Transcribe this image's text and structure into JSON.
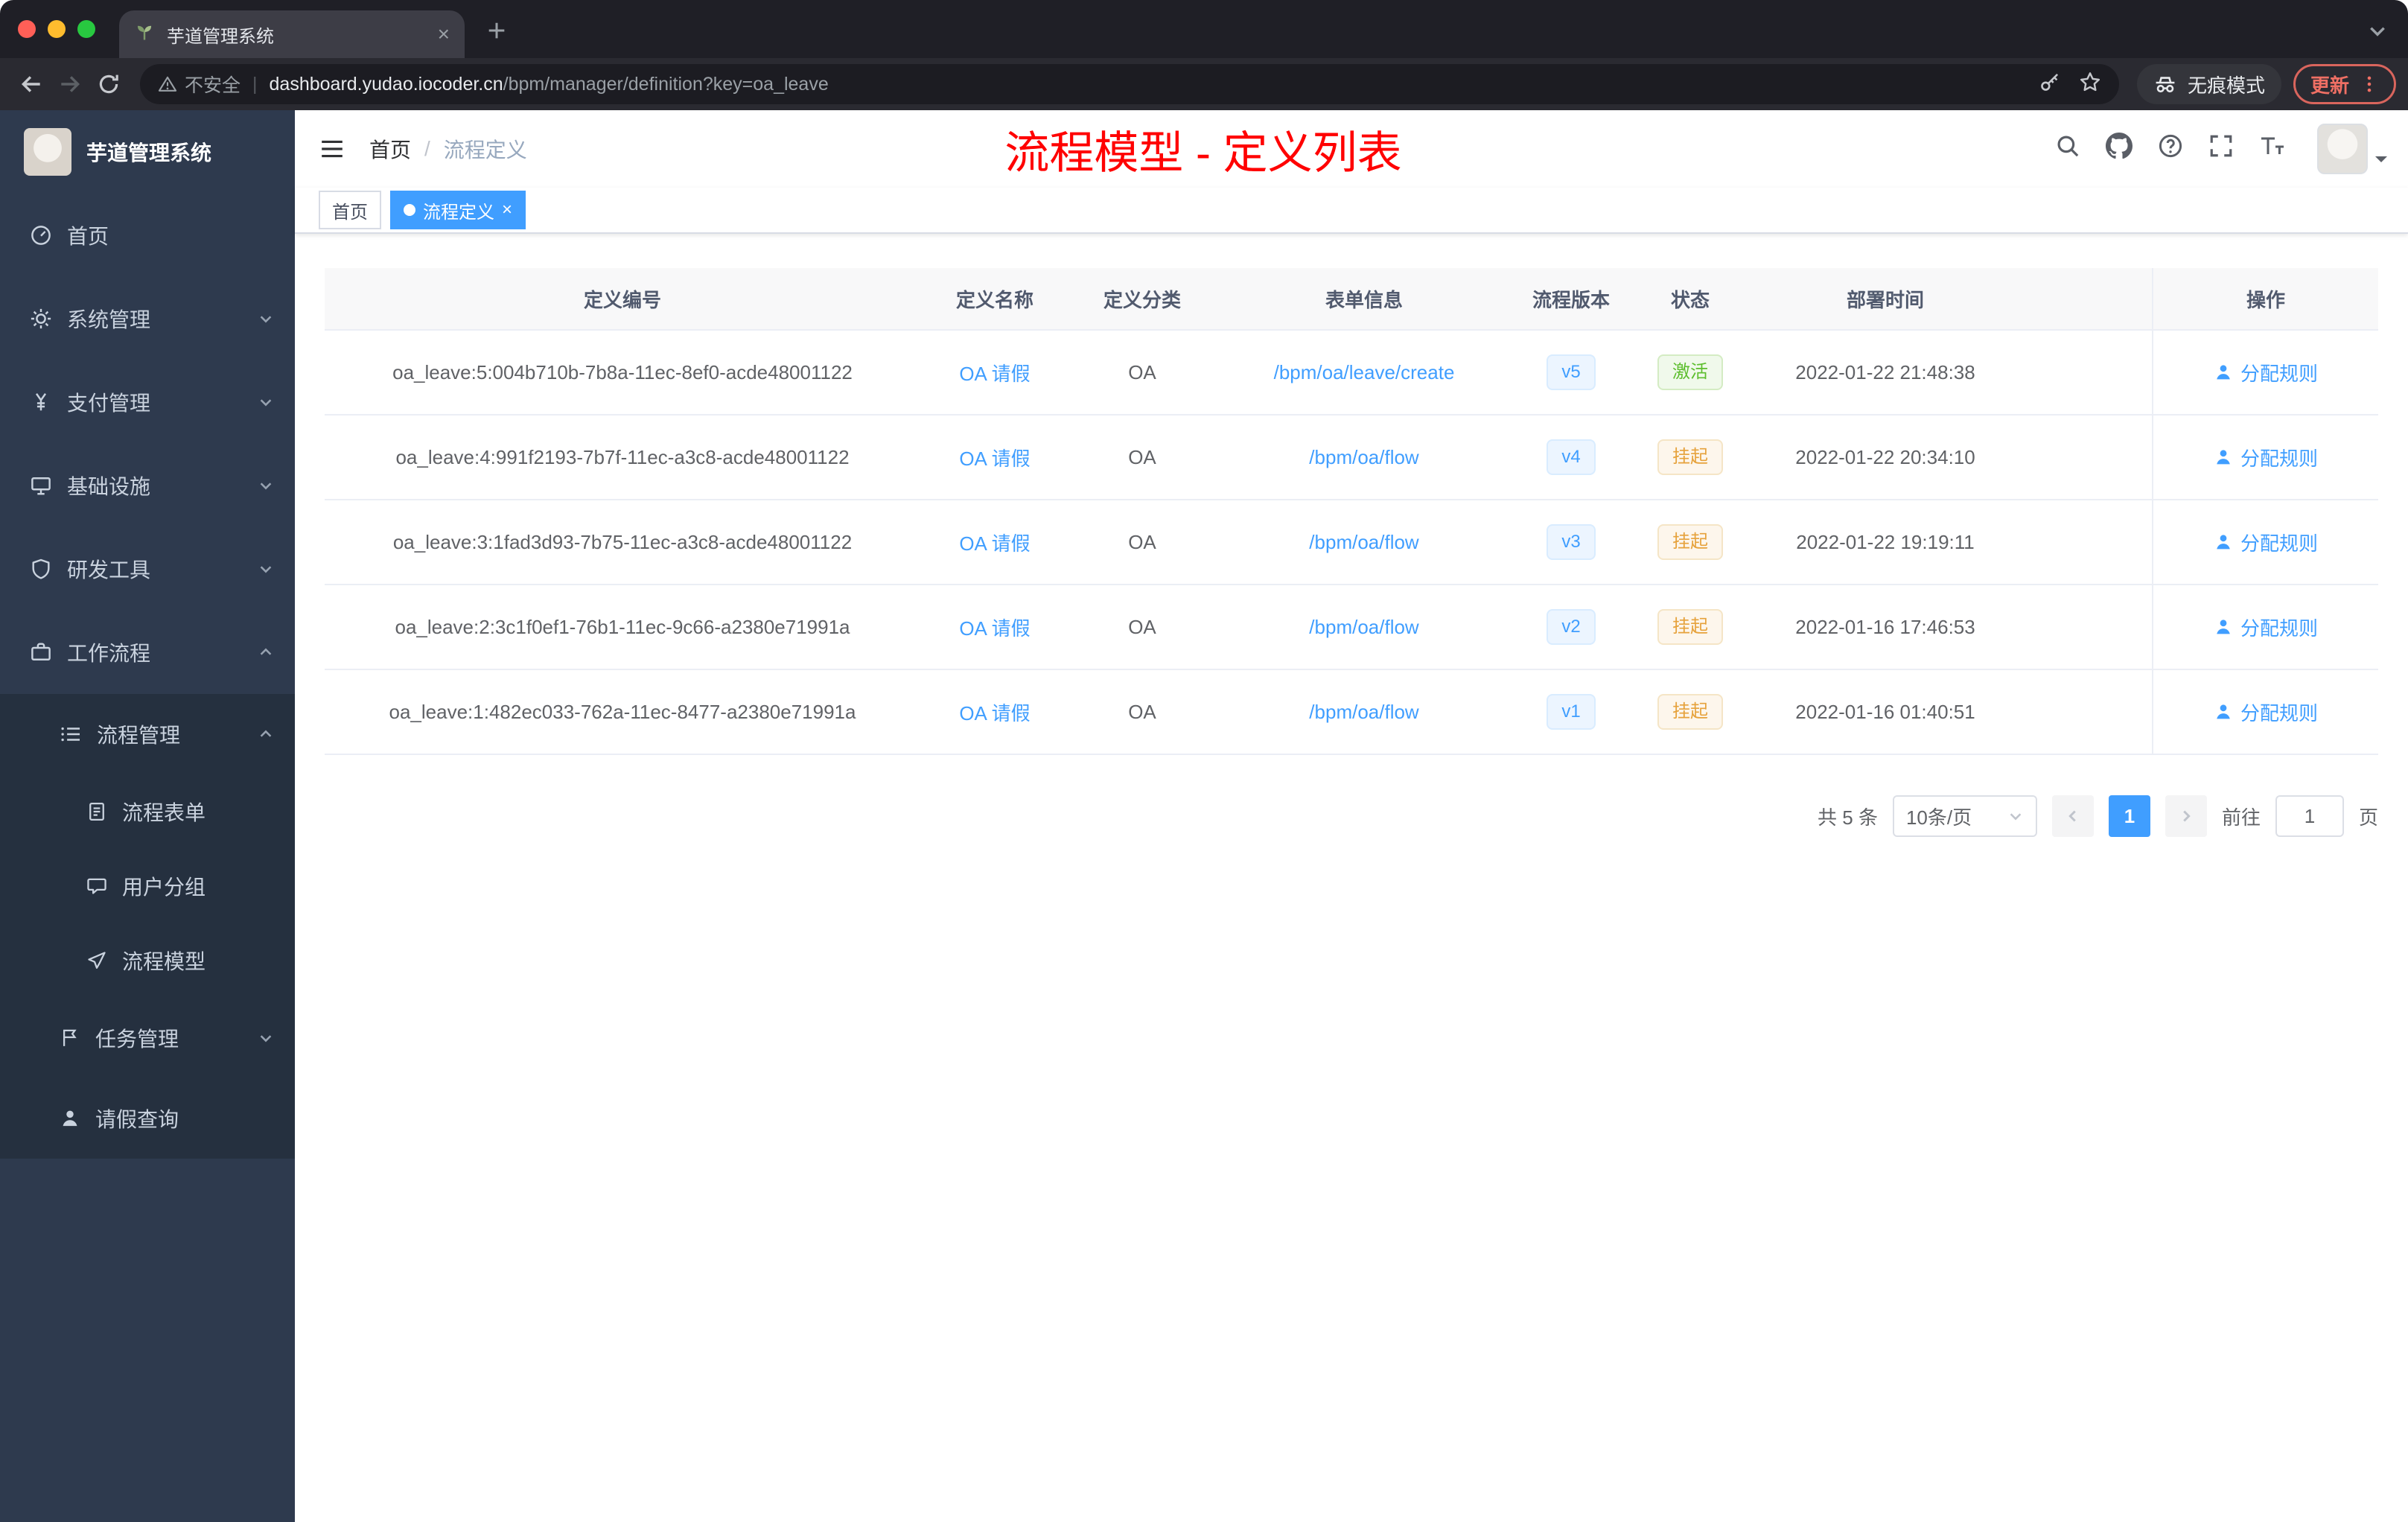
{
  "browser": {
    "tab_title": "芋道管理系统",
    "tab_close": "×",
    "security_label": "不安全",
    "url_domain": "dashboard.yudao.iocoder.cn",
    "url_path": "/bpm/manager/definition?key=oa_leave",
    "incognito_label": "无痕模式",
    "update_label": "更新"
  },
  "sidebar": {
    "logo_title": "芋道管理系统",
    "items": [
      {
        "label": "首页"
      },
      {
        "label": "系统管理"
      },
      {
        "label": "支付管理"
      },
      {
        "label": "基础设施"
      },
      {
        "label": "研发工具"
      },
      {
        "label": "工作流程"
      },
      {
        "label": "流程管理"
      },
      {
        "label": "流程表单"
      },
      {
        "label": "用户分组"
      },
      {
        "label": "流程模型"
      },
      {
        "label": "任务管理"
      },
      {
        "label": "请假查询"
      }
    ]
  },
  "navbar": {
    "breadcrumb_home": "首页",
    "breadcrumb_separator": "/",
    "breadcrumb_current": "流程定义",
    "page_title": "流程模型 - 定义列表"
  },
  "tags_view": {
    "home": "首页",
    "active": "流程定义",
    "close": "×"
  },
  "table": {
    "columns": [
      "定义编号",
      "定义名称",
      "定义分类",
      "表单信息",
      "流程版本",
      "状态",
      "部署时间",
      "操作"
    ],
    "rows": [
      {
        "id": "oa_leave:5:004b710b-7b8a-11ec-8ef0-acde48001122",
        "name": "OA 请假",
        "category": "OA",
        "form": "/bpm/oa/leave/create",
        "version": "v5",
        "status": "激活",
        "time": "2022-01-22 21:48:38",
        "action": "分配规则"
      },
      {
        "id": "oa_leave:4:991f2193-7b7f-11ec-a3c8-acde48001122",
        "name": "OA 请假",
        "category": "OA",
        "form": "/bpm/oa/flow",
        "version": "v4",
        "status": "挂起",
        "time": "2022-01-22 20:34:10",
        "action": "分配规则"
      },
      {
        "id": "oa_leave:3:1fad3d93-7b75-11ec-a3c8-acde48001122",
        "name": "OA 请假",
        "category": "OA",
        "form": "/bpm/oa/flow",
        "version": "v3",
        "status": "挂起",
        "time": "2022-01-22 19:19:11",
        "action": "分配规则"
      },
      {
        "id": "oa_leave:2:3c1f0ef1-76b1-11ec-9c66-a2380e71991a",
        "name": "OA 请假",
        "category": "OA",
        "form": "/bpm/oa/flow",
        "version": "v2",
        "status": "挂起",
        "time": "2022-01-16 17:46:53",
        "action": "分配规则"
      },
      {
        "id": "oa_leave:1:482ec033-762a-11ec-8477-a2380e71991a",
        "name": "OA 请假",
        "category": "OA",
        "form": "/bpm/oa/flow",
        "version": "v1",
        "status": "挂起",
        "time": "2022-01-16 01:40:51",
        "action": "分配规则"
      }
    ]
  },
  "pagination": {
    "total": "共 5 条",
    "page_size": "10条/页",
    "current_page": "1",
    "goto_label": "前往",
    "goto_value": "1",
    "page_unit": "页"
  },
  "colors": {
    "accent": "#409eff",
    "success": "#67c23a",
    "warning": "#e6a23c",
    "title_red": "#ff0000",
    "sidebar_bg": "#2e3a4e"
  }
}
